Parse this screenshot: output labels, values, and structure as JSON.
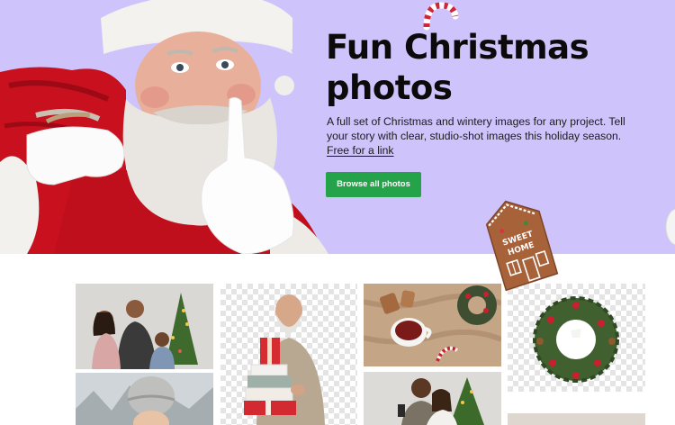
{
  "hero": {
    "title_line1": "Fun Christmas",
    "title_line2": "photos",
    "description": "A full set of Christmas and wintery images for any project. Tell your story with clear, studio-shot images this holiday season.",
    "link_text": "Free for a link",
    "cta_label": "Browse all photos",
    "background_color": "#cfc3fb",
    "cta_color": "#24a34a",
    "cookie_text_line1": "SWEET",
    "cookie_text_line2": "HOME"
  },
  "gallery": {
    "tiles": [
      {
        "subject": "family-by-christmas-tree",
        "transparent": false
      },
      {
        "subject": "man-holding-gift-stack",
        "transparent": true
      },
      {
        "subject": "mulled-wine-cozy-flatlay",
        "transparent": false
      },
      {
        "subject": "christmas-wreath",
        "transparent": true
      },
      {
        "subject": "woman-in-knit-hat-snow",
        "transparent": false
      },
      {
        "subject": "couple-with-phone-tree",
        "transparent": false
      },
      {
        "subject": "partial-tile",
        "transparent": false
      }
    ]
  }
}
